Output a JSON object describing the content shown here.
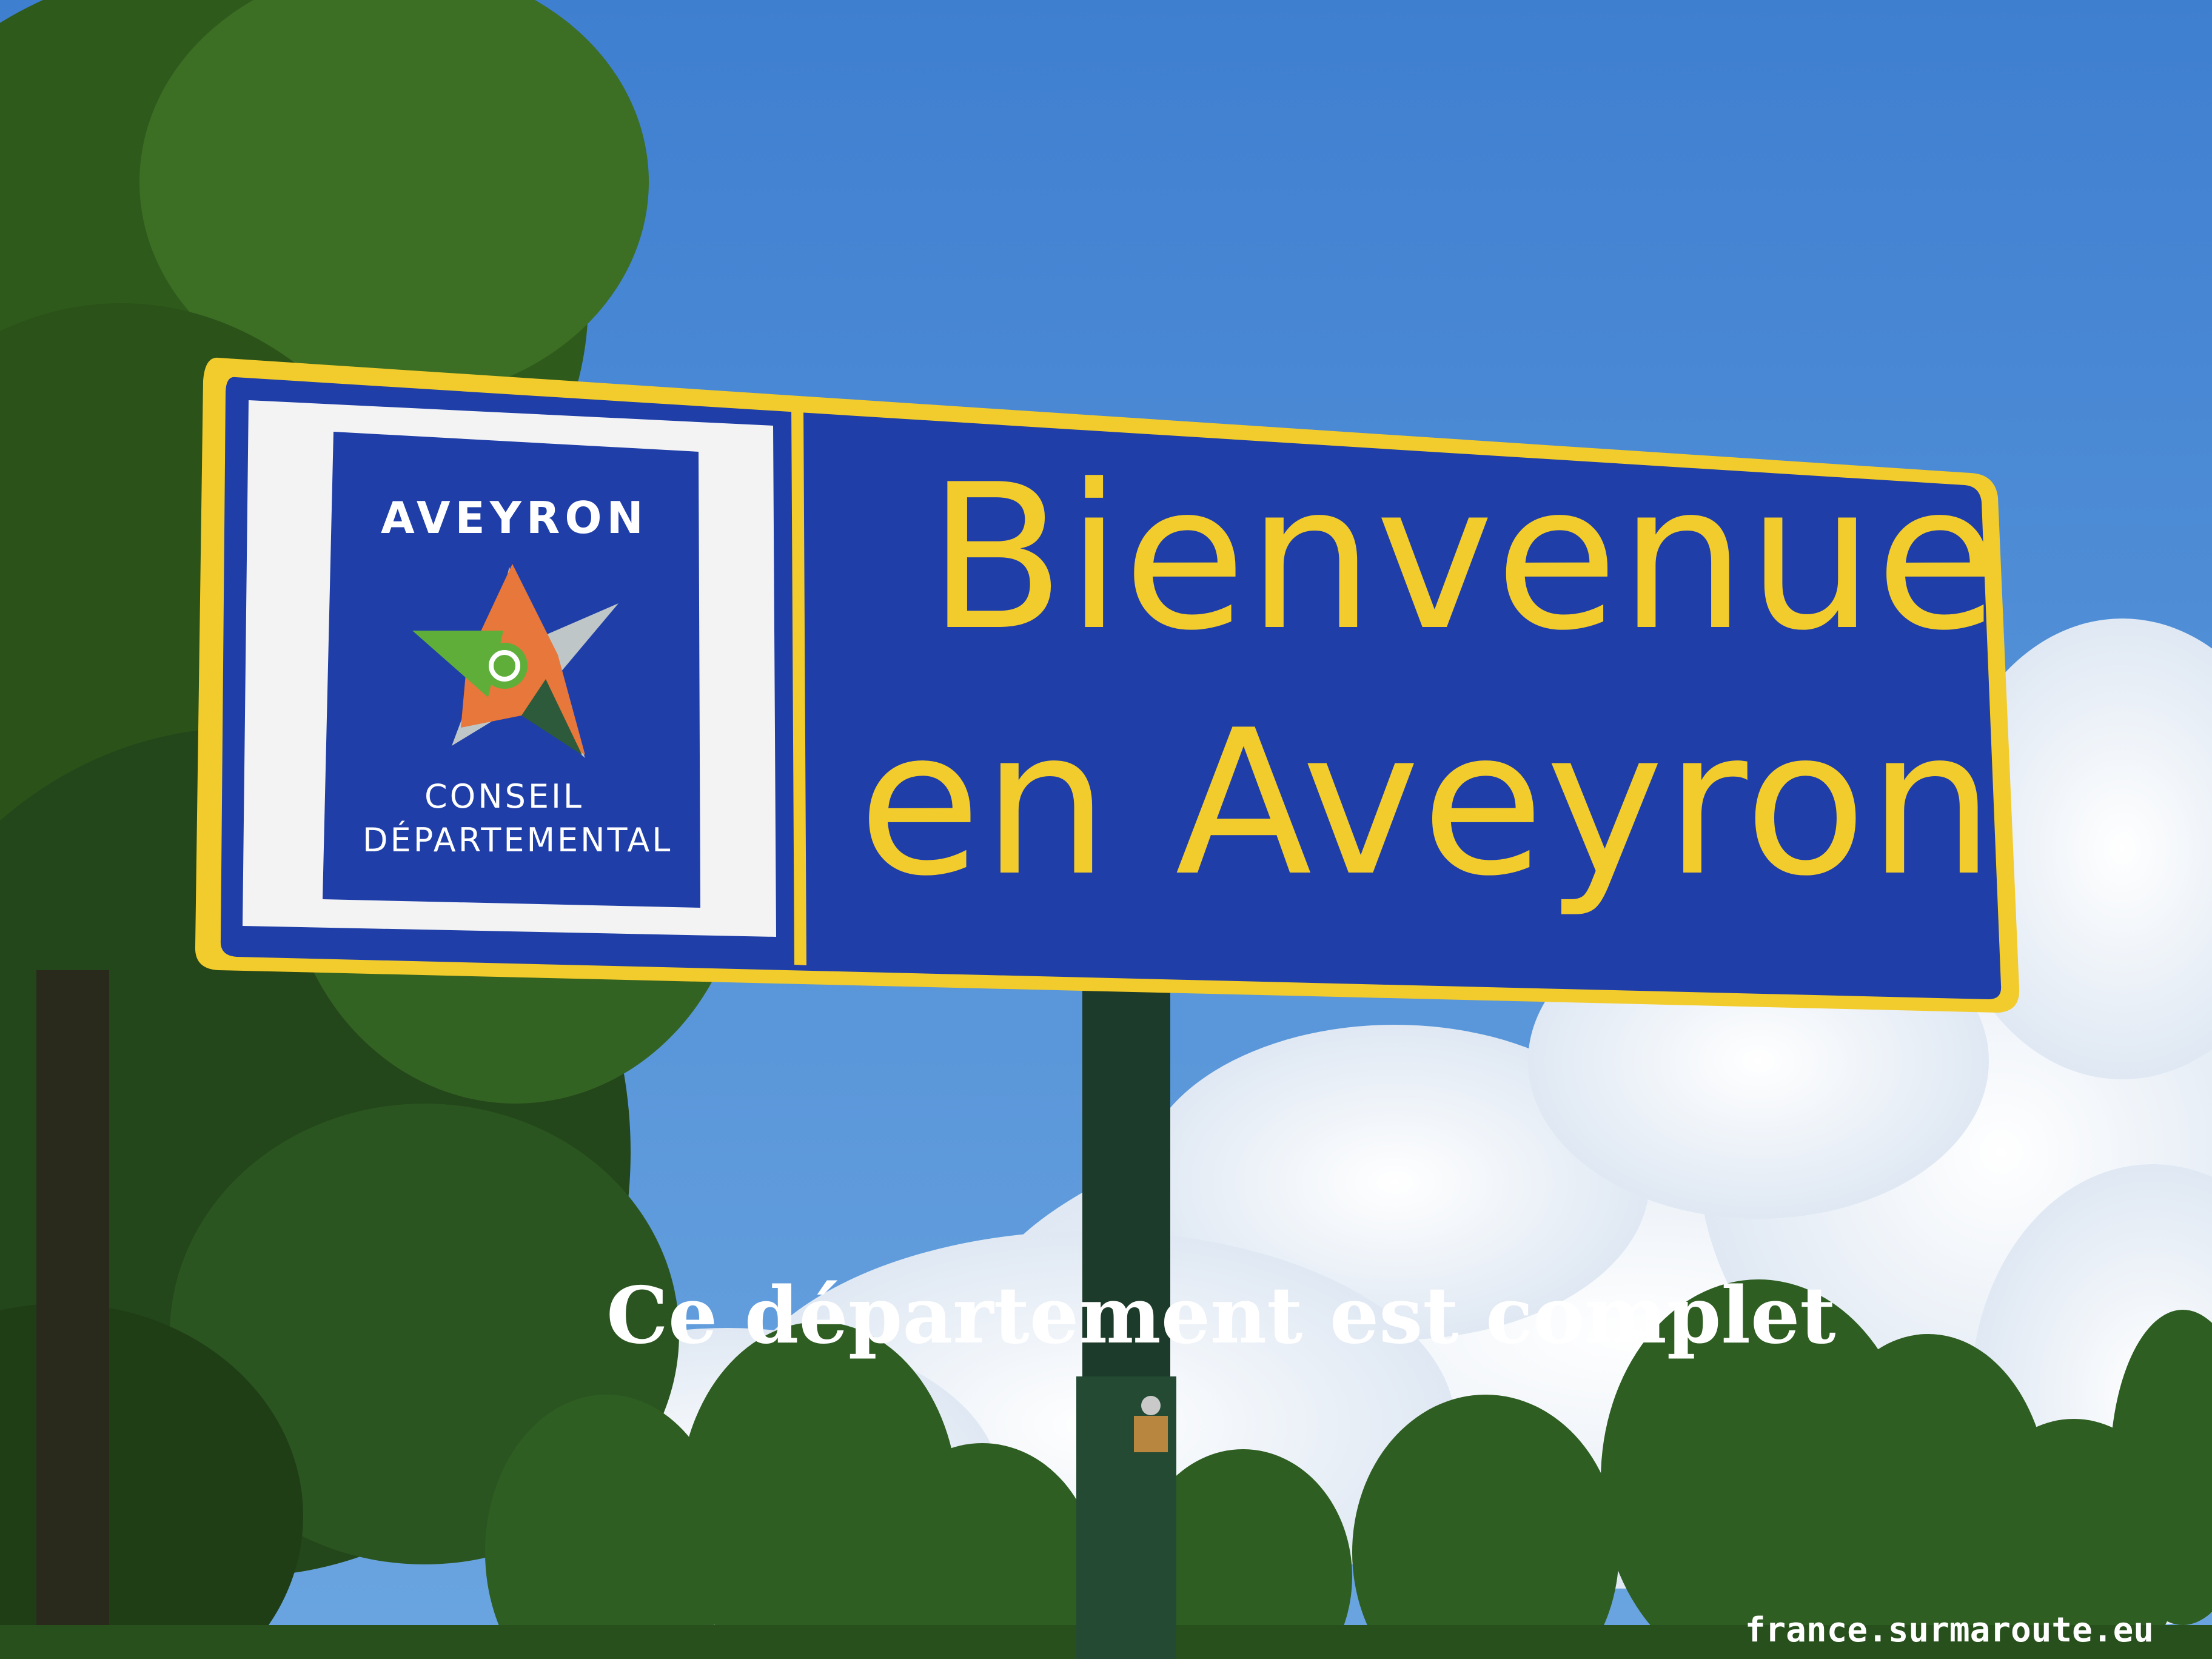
{
  "sign": {
    "logo": {
      "title": "AVEYRON",
      "subtitle_line1": "CONSEIL",
      "subtitle_line2": "DÉPARTEMENTAL"
    },
    "headline_line1": "Bienvenue",
    "headline_line2": "en Aveyron"
  },
  "caption": "Ce département est complet",
  "watermark": "france.surmaroute.eu",
  "colors": {
    "sky": "#4f8fd4",
    "sign_blue": "#1f3ea8",
    "sign_yellow": "#f2cb2c",
    "logo_orange": "#e7773a",
    "logo_green": "#5fae3a",
    "pole": "#1d3b2a"
  }
}
